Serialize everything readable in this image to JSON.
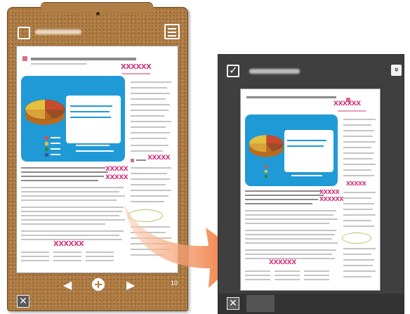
{
  "left_panel": {
    "xmarks": [
      "XXXXXX",
      "XXXXX",
      "XXXXX",
      "XXXXX",
      "XXXXXX"
    ],
    "page_number": "10",
    "nav": {
      "prev": "◀",
      "next": "▶"
    }
  },
  "right_panel": {
    "xmarks": [
      "XXXXXX",
      "XXXXX",
      "XXXXX",
      "XXXXXX",
      "XXXXXX"
    ]
  },
  "icons": {
    "checkbox_checked": "✓",
    "chevrons": "»",
    "exit": "✕"
  },
  "colors": {
    "cork": "#b07d45",
    "panel": "#3f3f3f",
    "markup": "#d6327b",
    "card": "#1f9ad6",
    "arrow": "#f07030"
  }
}
